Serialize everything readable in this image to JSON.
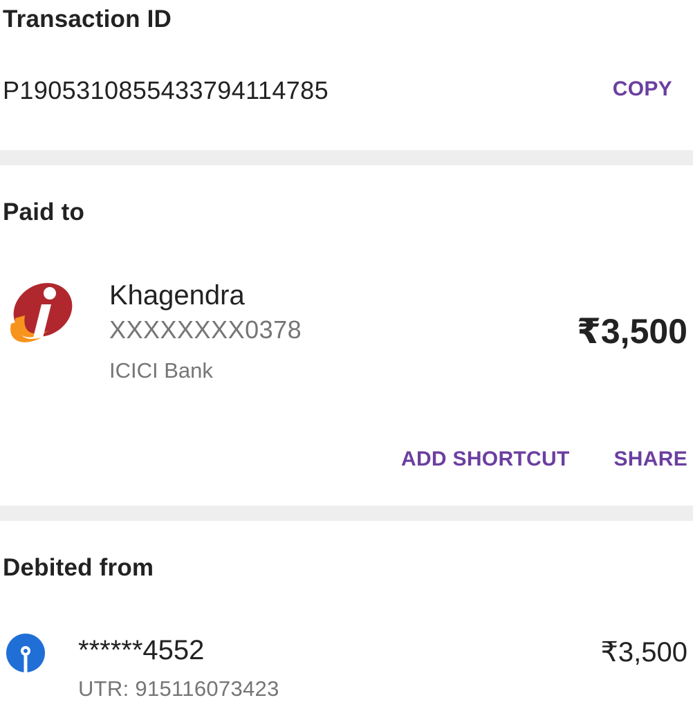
{
  "transaction": {
    "heading": "Transaction ID",
    "id": "P1905310855433794114785",
    "copy_label": "COPY"
  },
  "paid_to": {
    "heading": "Paid to",
    "logo_icon": "icici-bank-logo-icon",
    "name": "Khagendra",
    "account": "XXXXXXXX0378",
    "bank": "ICICI Bank",
    "amount": "₹3,500",
    "add_shortcut_label": "ADD SHORTCUT",
    "share_label": "SHARE"
  },
  "debited_from": {
    "heading": "Debited from",
    "logo_icon": "sbi-bank-logo-icon",
    "account": "******4552",
    "utr": "UTR: 915116073423",
    "amount": "₹3,500"
  },
  "colors": {
    "accent": "#6b3fa0",
    "divider": "#eeeeee",
    "icici_red": "#b0282e",
    "icici_orange": "#f7941d",
    "sbi_blue": "#1f6fd6"
  }
}
